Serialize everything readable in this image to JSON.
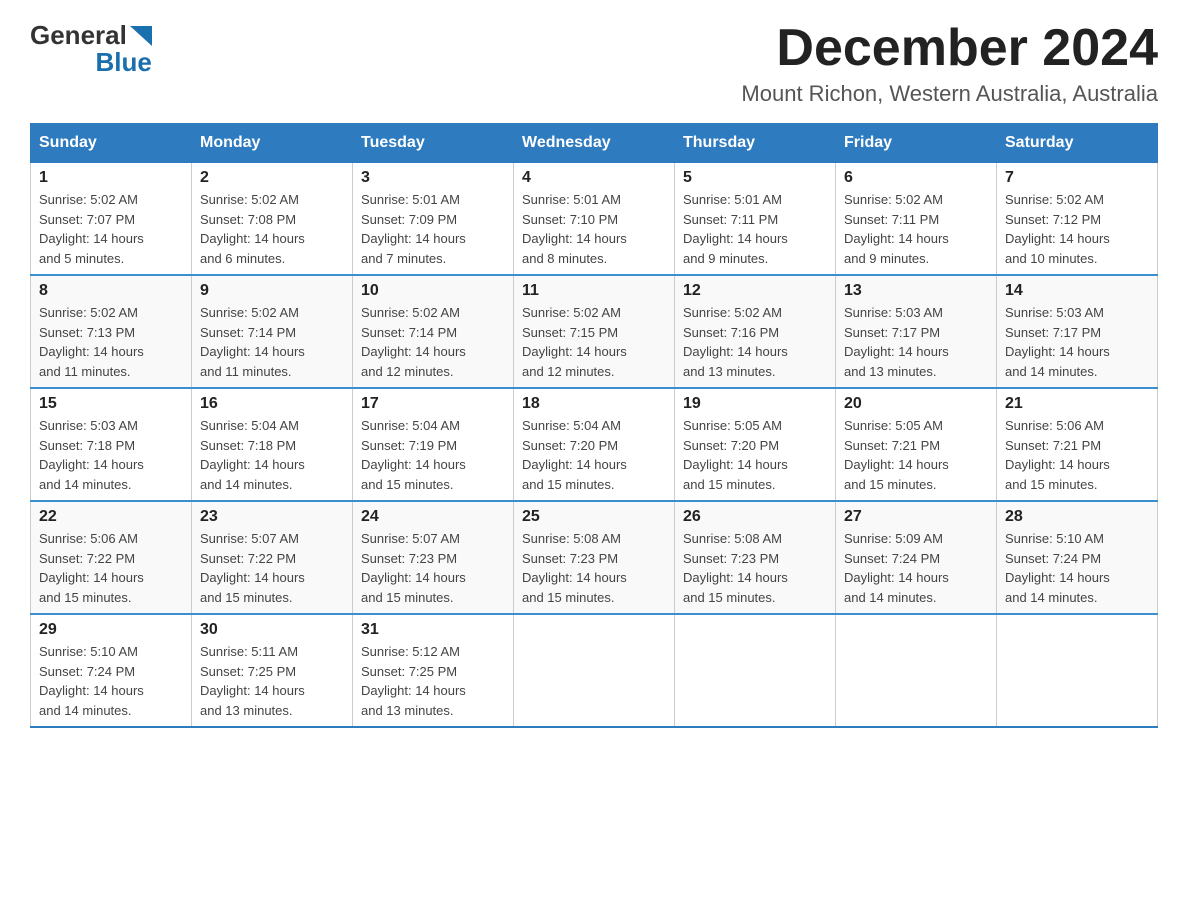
{
  "logo": {
    "general": "General",
    "blue": "Blue"
  },
  "title": {
    "month": "December 2024",
    "location": "Mount Richon, Western Australia, Australia"
  },
  "weekdays": [
    "Sunday",
    "Monday",
    "Tuesday",
    "Wednesday",
    "Thursday",
    "Friday",
    "Saturday"
  ],
  "weeks": [
    [
      {
        "day": "1",
        "sunrise": "5:02 AM",
        "sunset": "7:07 PM",
        "daylight": "14 hours and 5 minutes."
      },
      {
        "day": "2",
        "sunrise": "5:02 AM",
        "sunset": "7:08 PM",
        "daylight": "14 hours and 6 minutes."
      },
      {
        "day": "3",
        "sunrise": "5:01 AM",
        "sunset": "7:09 PM",
        "daylight": "14 hours and 7 minutes."
      },
      {
        "day": "4",
        "sunrise": "5:01 AM",
        "sunset": "7:10 PM",
        "daylight": "14 hours and 8 minutes."
      },
      {
        "day": "5",
        "sunrise": "5:01 AM",
        "sunset": "7:11 PM",
        "daylight": "14 hours and 9 minutes."
      },
      {
        "day": "6",
        "sunrise": "5:02 AM",
        "sunset": "7:11 PM",
        "daylight": "14 hours and 9 minutes."
      },
      {
        "day": "7",
        "sunrise": "5:02 AM",
        "sunset": "7:12 PM",
        "daylight": "14 hours and 10 minutes."
      }
    ],
    [
      {
        "day": "8",
        "sunrise": "5:02 AM",
        "sunset": "7:13 PM",
        "daylight": "14 hours and 11 minutes."
      },
      {
        "day": "9",
        "sunrise": "5:02 AM",
        "sunset": "7:14 PM",
        "daylight": "14 hours and 11 minutes."
      },
      {
        "day": "10",
        "sunrise": "5:02 AM",
        "sunset": "7:14 PM",
        "daylight": "14 hours and 12 minutes."
      },
      {
        "day": "11",
        "sunrise": "5:02 AM",
        "sunset": "7:15 PM",
        "daylight": "14 hours and 12 minutes."
      },
      {
        "day": "12",
        "sunrise": "5:02 AM",
        "sunset": "7:16 PM",
        "daylight": "14 hours and 13 minutes."
      },
      {
        "day": "13",
        "sunrise": "5:03 AM",
        "sunset": "7:17 PM",
        "daylight": "14 hours and 13 minutes."
      },
      {
        "day": "14",
        "sunrise": "5:03 AM",
        "sunset": "7:17 PM",
        "daylight": "14 hours and 14 minutes."
      }
    ],
    [
      {
        "day": "15",
        "sunrise": "5:03 AM",
        "sunset": "7:18 PM",
        "daylight": "14 hours and 14 minutes."
      },
      {
        "day": "16",
        "sunrise": "5:04 AM",
        "sunset": "7:18 PM",
        "daylight": "14 hours and 14 minutes."
      },
      {
        "day": "17",
        "sunrise": "5:04 AM",
        "sunset": "7:19 PM",
        "daylight": "14 hours and 15 minutes."
      },
      {
        "day": "18",
        "sunrise": "5:04 AM",
        "sunset": "7:20 PM",
        "daylight": "14 hours and 15 minutes."
      },
      {
        "day": "19",
        "sunrise": "5:05 AM",
        "sunset": "7:20 PM",
        "daylight": "14 hours and 15 minutes."
      },
      {
        "day": "20",
        "sunrise": "5:05 AM",
        "sunset": "7:21 PM",
        "daylight": "14 hours and 15 minutes."
      },
      {
        "day": "21",
        "sunrise": "5:06 AM",
        "sunset": "7:21 PM",
        "daylight": "14 hours and 15 minutes."
      }
    ],
    [
      {
        "day": "22",
        "sunrise": "5:06 AM",
        "sunset": "7:22 PM",
        "daylight": "14 hours and 15 minutes."
      },
      {
        "day": "23",
        "sunrise": "5:07 AM",
        "sunset": "7:22 PM",
        "daylight": "14 hours and 15 minutes."
      },
      {
        "day": "24",
        "sunrise": "5:07 AM",
        "sunset": "7:23 PM",
        "daylight": "14 hours and 15 minutes."
      },
      {
        "day": "25",
        "sunrise": "5:08 AM",
        "sunset": "7:23 PM",
        "daylight": "14 hours and 15 minutes."
      },
      {
        "day": "26",
        "sunrise": "5:08 AM",
        "sunset": "7:23 PM",
        "daylight": "14 hours and 15 minutes."
      },
      {
        "day": "27",
        "sunrise": "5:09 AM",
        "sunset": "7:24 PM",
        "daylight": "14 hours and 14 minutes."
      },
      {
        "day": "28",
        "sunrise": "5:10 AM",
        "sunset": "7:24 PM",
        "daylight": "14 hours and 14 minutes."
      }
    ],
    [
      {
        "day": "29",
        "sunrise": "5:10 AM",
        "sunset": "7:24 PM",
        "daylight": "14 hours and 14 minutes."
      },
      {
        "day": "30",
        "sunrise": "5:11 AM",
        "sunset": "7:25 PM",
        "daylight": "14 hours and 13 minutes."
      },
      {
        "day": "31",
        "sunrise": "5:12 AM",
        "sunset": "7:25 PM",
        "daylight": "14 hours and 13 minutes."
      },
      null,
      null,
      null,
      null
    ]
  ],
  "labels": {
    "sunrise": "Sunrise:",
    "sunset": "Sunset:",
    "daylight": "Daylight:"
  }
}
